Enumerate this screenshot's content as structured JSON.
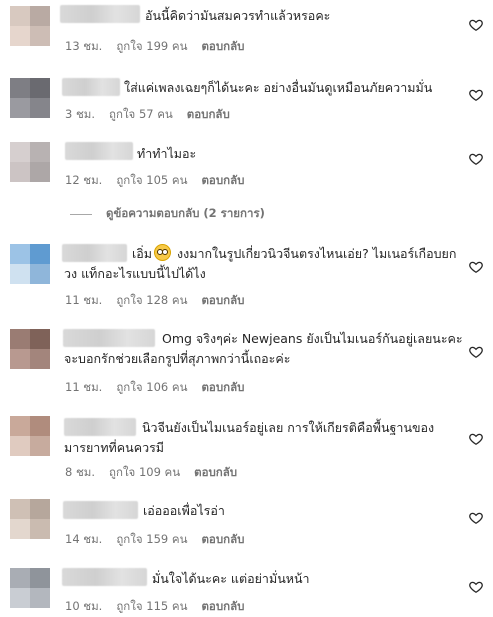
{
  "labels": {
    "like": "ถูกใจ",
    "like_unit": "คน",
    "reply": "ตอบกลับ"
  },
  "view_replies": "ดูข้อความตอบกลับ (2 รายการ)",
  "comments": [
    {
      "text": "อันนี้คิดว่ามันสมควรทำแล้วหรอคะ",
      "time": "13 ชม.",
      "likes": "ถูกใจ 199 คน",
      "avatar_colors": [
        "#d8c9c0",
        "#b9aaa3",
        "#e6d6cd",
        "#cdbdb5"
      ]
    },
    {
      "text": "ใส่แค่เพลงเฉยๆก็ได้นะคะ อย่างอื่นมันดูเหมือนภัยความมั่น",
      "time": "3 ชม.",
      "likes": "ถูกใจ 57 คน",
      "avatar_colors": [
        "#7e7e84",
        "#6a6a70",
        "#9a9aa0",
        "#85858b"
      ]
    },
    {
      "text": "ทำทำไมอะ",
      "time": "12 ชม.",
      "likes": "ถูกใจ 105 คน",
      "avatar_colors": [
        "#d6cfcf",
        "#b8b2b2",
        "#ccc4c4",
        "#ada7a7"
      ]
    },
    {
      "text": "เอิ่ม",
      "text_after": " งงมากในรูปเกี่ยวนิวจีนตรงไหนเอ่ย? ไมเนอร์เกือบยกวง แท็กอะไรแบบนี้ไปได้ไง",
      "time": "11 ชม.",
      "likes": "ถูกใจ 128 คน",
      "avatar_colors": [
        "#9cc3e6",
        "#5f9bd1",
        "#cfe1f0",
        "#8fb6da"
      ]
    },
    {
      "text": "Omg จริงๆค่ะ Newjeans ยังเป็นไมเนอร์กันอยู่เลยนะคะ จะบอกรักช่วยเลือกรูปที่สุภาพกว่านี้เถอะค่ะ",
      "time": "11 ชม.",
      "likes": "ถูกใจ 106 คน",
      "avatar_colors": [
        "#9a7c73",
        "#7f6259",
        "#b89990",
        "#a3857c"
      ]
    },
    {
      "text": "นิวจีนยังเป็นไมเนอร์อยู่เลย การให้เกียรติคือพื้นฐานของมารยาทที่คนควรมี",
      "time": "8 ชม.",
      "likes": "ถูกใจ 109 คน",
      "avatar_colors": [
        "#c9a99a",
        "#b08c7d",
        "#e0cbc0",
        "#c7ab9e"
      ]
    },
    {
      "text": "เอ่อออเพื่อไรอ่า",
      "time": "14 ชม.",
      "likes": "ถูกใจ 159 คน",
      "avatar_colors": [
        "#cfc0b5",
        "#b6a79c",
        "#e3d7ce",
        "#cabbb0"
      ]
    },
    {
      "text": "มั่นใจได้นะคะ แต่อย่ามั่นหน้า",
      "time": "10 ชม.",
      "likes": "ถูกใจ 115 คน",
      "avatar_colors": [
        "#a9adb4",
        "#8f949b",
        "#c9cdd3",
        "#b3b7be"
      ]
    }
  ]
}
